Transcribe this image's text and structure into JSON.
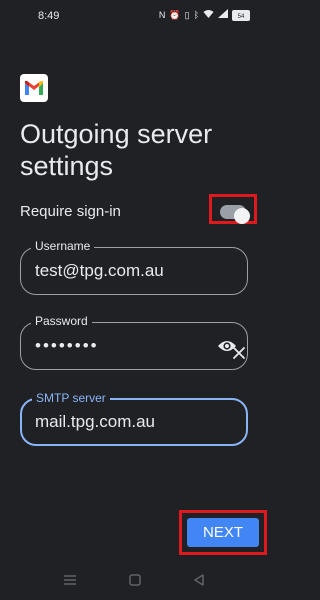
{
  "status_bar": {
    "time": "8:49",
    "battery_level": "54"
  },
  "page": {
    "title": "Outgoing server settings"
  },
  "require_signin": {
    "label": "Require sign-in",
    "enabled": true
  },
  "fields": {
    "username": {
      "label": "Username",
      "value": "test@tpg.com.au"
    },
    "password": {
      "label": "Password",
      "value": "••••••••"
    },
    "smtp_server": {
      "label": "SMTP server",
      "value": "mail.tpg.com.au"
    }
  },
  "actions": {
    "next_label": "NEXT"
  },
  "icons": {
    "app_logo": "gmail-logo",
    "password_visibility": "eye-icon",
    "clear": "close-icon",
    "nav_menu": "menu-icon",
    "nav_home": "home-icon",
    "nav_back": "back-icon"
  },
  "colors": {
    "background": "#202124",
    "accent": "#8ab4f8",
    "button": "#4285f4",
    "highlight": "#e0191f"
  }
}
